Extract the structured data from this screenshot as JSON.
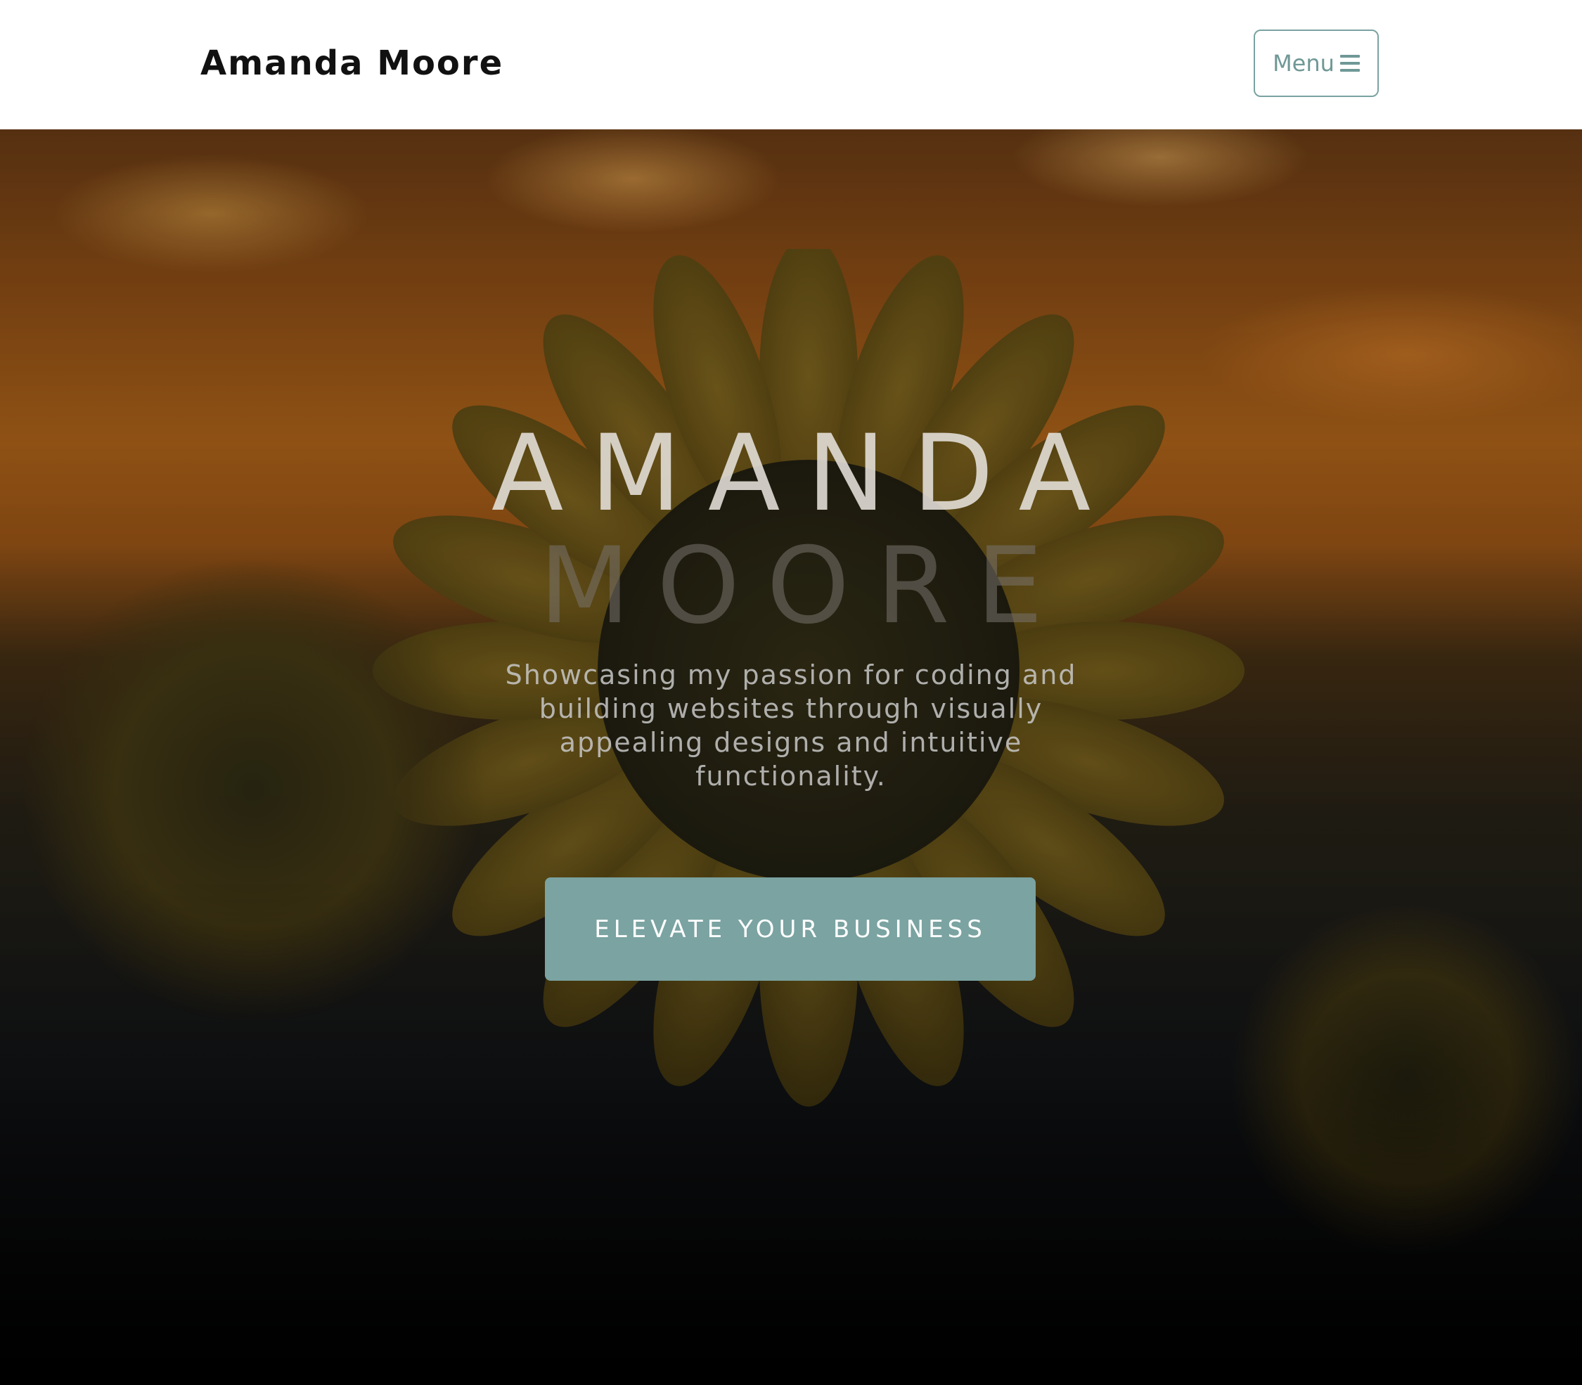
{
  "navbar": {
    "brand": "Amanda Moore",
    "menu_label": "Menu",
    "menu_icon": "bars-icon"
  },
  "hero": {
    "title_first": "AMANDA",
    "title_last": "MOORE",
    "tagline": "Showcasing my passion for coding and building websites through visually appealing designs and intuitive functionality.",
    "cta_label": "ELEVATE YOUR BUSINESS",
    "background_image": "sunflower-field-at-sunset"
  },
  "colors": {
    "accent": "#7aa3a1",
    "navbar_bg": "#ffffff",
    "brand_text": "#111111"
  }
}
